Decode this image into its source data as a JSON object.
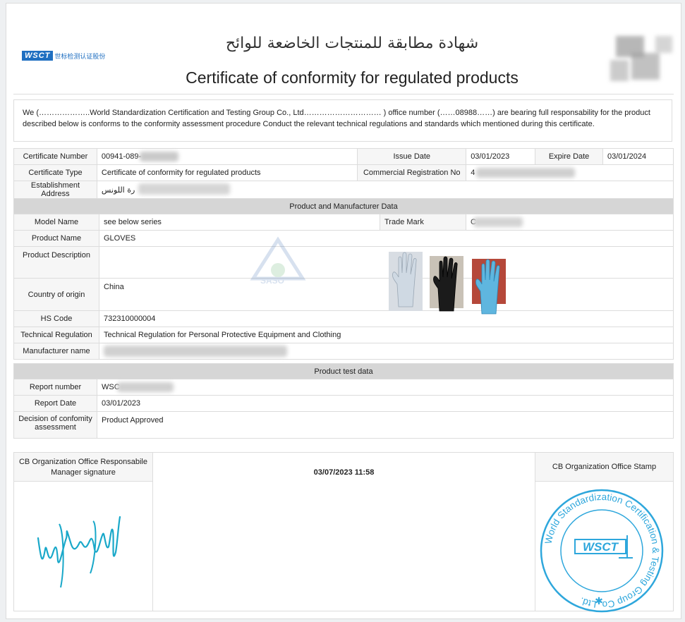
{
  "header": {
    "logo_text": "WSCT",
    "logo_sub": "世标检测认证股份",
    "title_ar": "شهادة مطابقة للمنتجات الخاضعة للوائح",
    "title_en": "Certificate of conformity for regulated products"
  },
  "intro": {
    "line1": "We (………………..World Standardization Certification and Testing Group Co., Ltd………………………… ) office number (……08988……) are bearing full responsability for the product",
    "line2": "described below is conforms to the conformity assessment procedure Conduct the relevant technical regulations and standards which mentioned during this certificate."
  },
  "cert": {
    "number_label": "Certificate Number",
    "number_value": "00941-089-",
    "issue_label": "Issue Date",
    "issue_value": "03/01/2023",
    "expire_label": "Expire Date",
    "expire_value": "03/01/2024",
    "type_label": "Certificate Type",
    "type_value": "Certificate of conformity for regulated products",
    "cr_label": "Commercial Registration No",
    "cr_value": "4",
    "address_label": "Establishment Address",
    "address_value": "رة اللونس"
  },
  "product": {
    "section_title": "Product and Manufacturer Data",
    "model_label": "Model Name",
    "model_value": "see below series",
    "trademark_label": "Trade Mark",
    "trademark_value": "C",
    "name_label": "Product Name",
    "name_value": "GLOVES",
    "desc_label": "Product Description",
    "origin_label": "Country of origin",
    "origin_value": "China",
    "hs_label": "HS Code",
    "hs_value": "732310000004",
    "reg_label": "Technical Regulation",
    "reg_value": "Technical Regulation for Personal Protective Equipment and Clothing",
    "manufacturer_label": "Manufacturer name",
    "images": [
      {
        "name": "clear vinyl glove",
        "color": "#cfd9e3"
      },
      {
        "name": "black nitrile glove",
        "color": "#1b1b1b"
      },
      {
        "name": "blue nitrile glove",
        "color": "#5fb6df"
      }
    ]
  },
  "test": {
    "section_title": "Product test data",
    "report_label": "Report number",
    "report_value": "WSC",
    "date_label": "Report Date",
    "date_value": "03/01/2023",
    "decision_label": "Decision of confomity assessment",
    "decision_value": "Product Approved"
  },
  "signature": {
    "manager_label": "CB Organization Office Responsabile Manager signature",
    "timestamp": "03/07/2023 11:58",
    "stamp_label": "CB Organization Office Stamp",
    "stamp_ring_text": "World Standardization Certification & Testing Group Co.,Ltd.",
    "stamp_center": "WSCT"
  },
  "watermark": {
    "text": "SASO"
  },
  "colors": {
    "brand": "#1f6fc1",
    "stamp": "#2ea7dc",
    "signature": "#19a8c9",
    "band": "#d6d6d6"
  }
}
